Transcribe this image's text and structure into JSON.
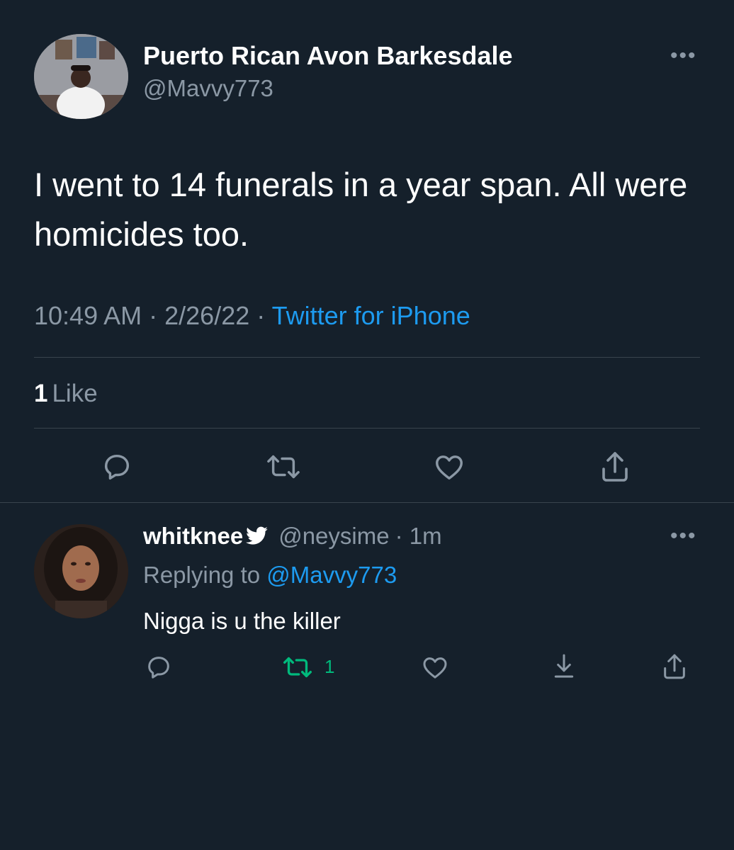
{
  "main_tweet": {
    "display_name": "Puerto Rican Avon Barkesdale",
    "handle": "@Mavvy773",
    "text": "I went to 14 funerals in a year span. All were homicides too.",
    "time": "10:49 AM",
    "date": "2/26/22",
    "source": "Twitter for iPhone",
    "separator": "·",
    "likes_count": "1",
    "likes_label": "Like",
    "more_label": "•••",
    "actions": [
      "reply-icon",
      "retweet-icon",
      "like-icon",
      "share-icon"
    ]
  },
  "reply": {
    "display_name": "whitknee",
    "handle": "@neysime",
    "time": "· 1m",
    "replying_to_label": "Replying to",
    "replying_to_handle": "@Mavvy773",
    "text": "Nigga is u the killer",
    "retweet_count": "1",
    "more_label": "•••",
    "actions": [
      "reply-icon",
      "retweet-icon",
      "like-icon",
      "download-icon",
      "share-icon"
    ]
  },
  "colors": {
    "background": "#15202b",
    "text_primary": "#ffffff",
    "text_secondary": "#8b98a5",
    "link": "#1d9bf0",
    "retweet_active": "#00ba7c",
    "divider": "#38444d"
  }
}
